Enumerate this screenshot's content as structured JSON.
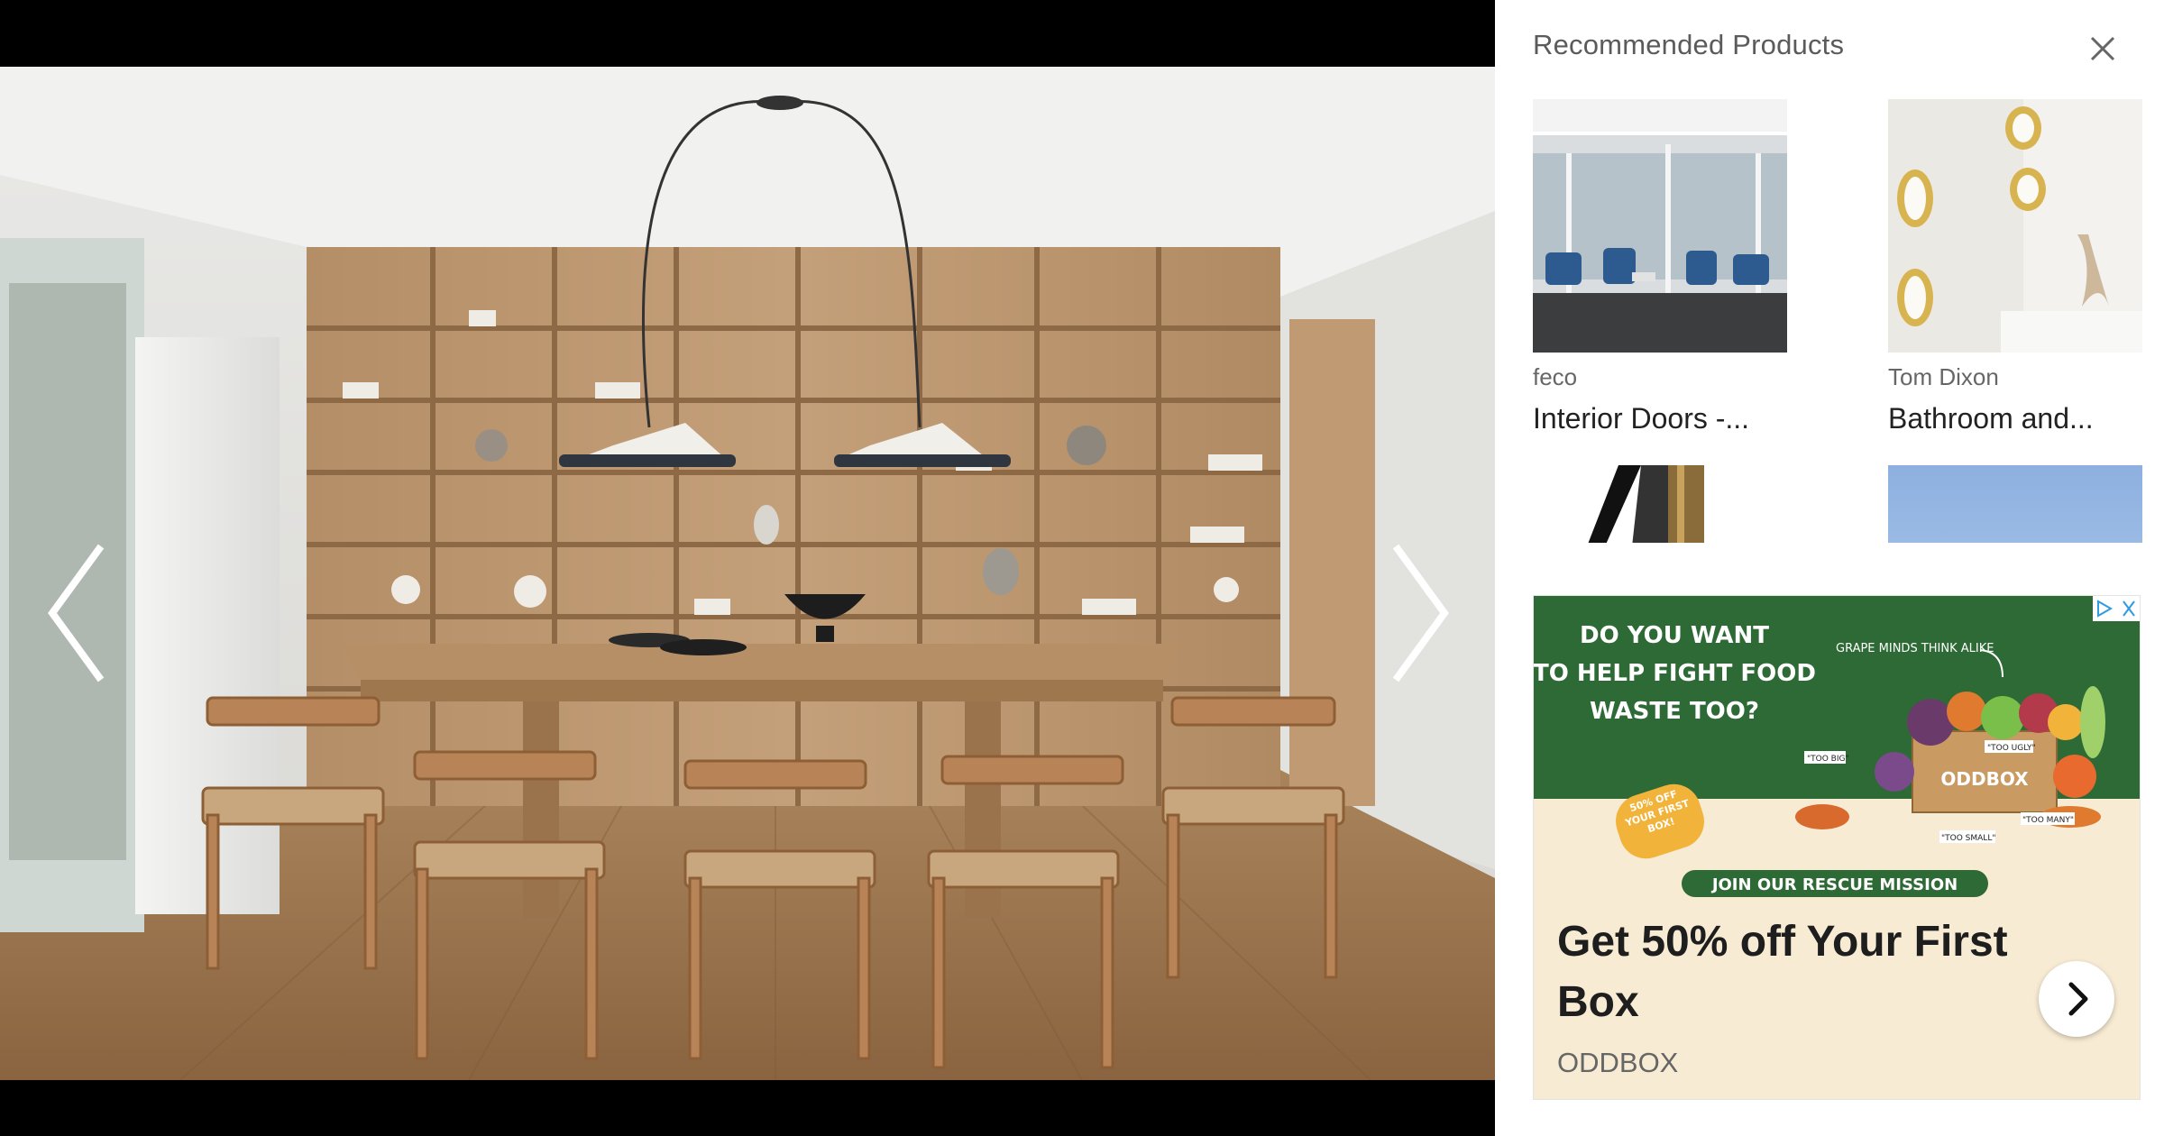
{
  "panel": {
    "title": "Recommended Products",
    "close_icon": "close-icon"
  },
  "products": [
    {
      "brand": "feco",
      "name": "Interior Doors -..."
    },
    {
      "brand": "Tom Dixon",
      "name": "Bathroom and..."
    }
  ],
  "viewer": {
    "prev_icon": "chevron-left-icon",
    "next_icon": "chevron-right-icon"
  },
  "ad": {
    "banner_line1": "DO YOU WANT",
    "banner_line2": "TO HELP FIGHT FOOD",
    "banner_line3": "WASTE TOO?",
    "tagline": "GRAPE MINDS THINK ALIKE",
    "offer_sticker": "50% OFF YOUR FIRST BOX!",
    "box_label": "ODDBOX",
    "tag_too_ugly": "\"TOO UGLY\"",
    "tag_too_big": "\"TOO BIG\"",
    "tag_too_small": "\"TOO SMALL\"",
    "tag_too_many": "\"TOO MANY\"",
    "mission_button": "JOIN OUR RESCUE MISSION",
    "headline": "Get 50% off Your First Box",
    "advertiser": "ODDBOX",
    "cta_icon": "chevron-right-icon",
    "adchoices_icon": "adchoices-icon",
    "colors": {
      "banner_green": "#2e6a35",
      "cream": "#f7ebd3",
      "sticker": "#f2b33a"
    }
  }
}
